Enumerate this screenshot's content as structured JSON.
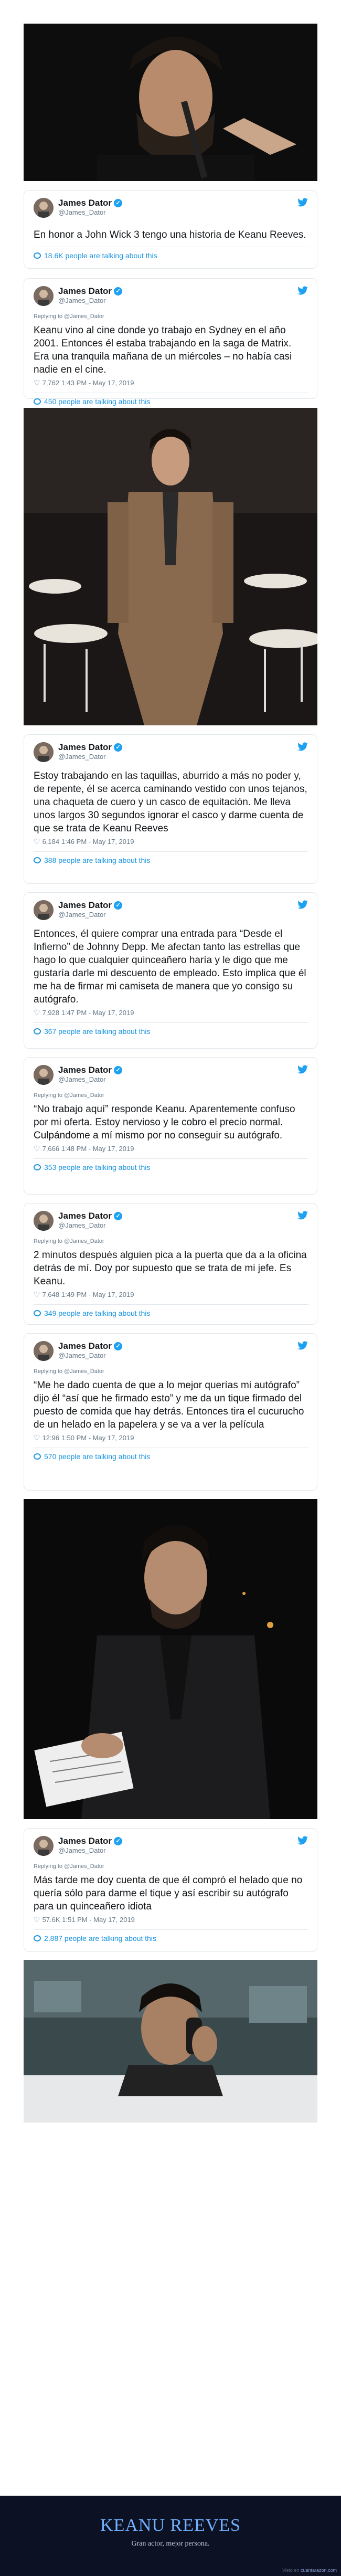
{
  "tweets": [
    {
      "name": "James Dator",
      "handle": "@James_Dator",
      "reply": "",
      "text": "En honor a John Wick 3 tengo una historia de Keanu Reeves.",
      "likes": "",
      "time": "",
      "talking": "18.6K people are talking about this"
    },
    {
      "name": "James Dator",
      "handle": "@James_Dator",
      "reply": "Replying to @James_Dator",
      "text": "Keanu vino al cine donde yo trabajo en Sydney en el año 2001. Entonces él estaba trabajando en la saga de Matrix. Era una tranquila mañana de un miércoles – no había casi nadie en el cine.",
      "likes": "7,762",
      "time": "1:43 PM - May 17, 2019",
      "talking": "450 people are talking about this"
    },
    {
      "name": "James Dator",
      "handle": "@James_Dator",
      "reply": "",
      "text": "Estoy trabajando en las taquillas, aburrido a más no poder y, de repente, él se acerca caminando vestido con unos tejanos, una chaqueta de cuero y un casco de equitación. Me lleva unos largos 30 segundos ignorar el casco y darme cuenta de que se trata de Keanu Reeves",
      "likes": "6,184",
      "time": "1:46 PM - May 17, 2019",
      "talking": "388 people are talking about this"
    },
    {
      "name": "James Dator",
      "handle": "@James_Dator",
      "reply": "",
      "text": "Entonces, él quiere comprar  una entrada para “Desde el Infierno” de Johnny Depp. Me afectan tanto las estrellas que hago lo que cualquier quinceañero haría y le digo que me gustaría darle mi descuento de empleado. Esto implica que él me ha de firmar mi camiseta de manera que yo consigo su autógrafo.",
      "likes": "7,928",
      "time": "1:47 PM - May 17, 2019",
      "talking": "367 people are talking about this"
    },
    {
      "name": "James Dator",
      "handle": "@James_Dator",
      "reply": "Replying to @James_Dator",
      "text": "“No trabajo aquí” responde Keanu. Aparentemente confuso por mi oferta. Estoy nervioso y le cobro el precio normal. Culpándome a mí mismo por no conseguir su autógrafo.",
      "likes": "7,666",
      "time": "1:48 PM - May 17, 2019",
      "talking": "353 people are talking about this"
    },
    {
      "name": "James Dator",
      "handle": "@James_Dator",
      "reply": "Replying to @James_Dator",
      "text": "2 minutos después alguien pica a la puerta que da a la oficina detrás de mí. Doy por supuesto que se trata de mi jefe. Es Keanu.",
      "likes": "7,648",
      "time": "1:49 PM - May 17, 2019",
      "talking": "349 people are talking about this"
    },
    {
      "name": "James Dator",
      "handle": "@James_Dator",
      "reply": "Replying to @James_Dator",
      "text": "“Me he dado cuenta de que a lo mejor querías mi autógrafo” dijo él “así que he firmado esto” y me da un tique firmado del puesto de comida que hay detrás. Entonces tira el cucurucho de un helado en la papelera y se va a ver la película",
      "likes": "",
      "time": "12:96  1:50 PM - May 17, 2019",
      "talking": "570 people are talking about this"
    },
    {
      "name": "James Dator",
      "handle": "@James_Dator",
      "reply": "Replying to @James_Dator",
      "text": "Más tarde me doy cuenta de que él compró el helado que no quería sólo para darme el tique y así escribir su autógrafo para un quinceañero idiota",
      "likes": "57.6K",
      "time": "1:51 PM - May 17, 2019",
      "talking": "2,887 people are talking about this"
    }
  ],
  "footer": {
    "title": "KEANU REEVES",
    "subtitle": "Gran actor, mejor persona.",
    "watermark_prefix": "Visto en ",
    "watermark_site": "cuantarazon.com"
  },
  "colors": {
    "verified": "#1da1f2",
    "link": "#1b95e0",
    "footer_bg": "#0c1124",
    "footer_title": "#6fb0ff"
  },
  "icons": {
    "bird": "twitter-bird-icon",
    "heart": "heart-icon",
    "verified": "verified-badge-icon",
    "bubble": "speech-bubble-icon"
  }
}
